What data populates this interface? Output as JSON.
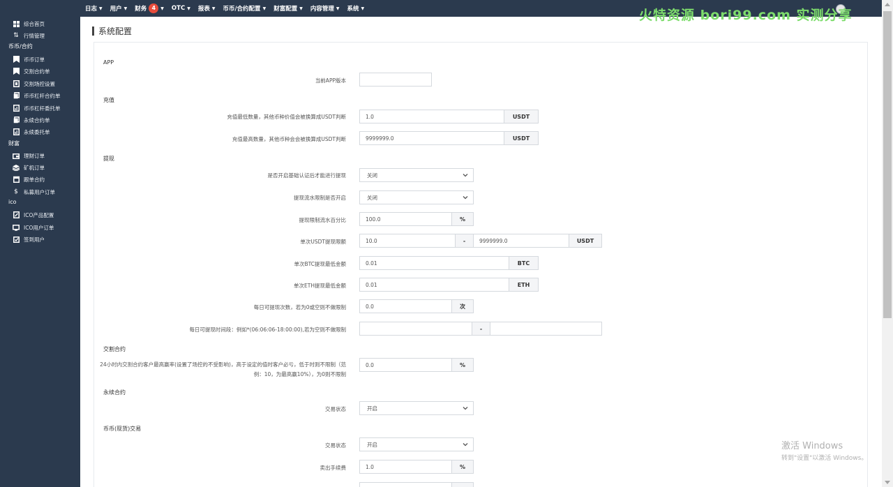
{
  "topnav": {
    "menu": [
      {
        "label": "日志"
      },
      {
        "label": "用户"
      },
      {
        "label": "财务",
        "badge": "4"
      },
      {
        "label": "OTC"
      },
      {
        "label": "报表"
      },
      {
        "label": "币币/合约配置"
      },
      {
        "label": "财富配置"
      },
      {
        "label": "内容管理"
      },
      {
        "label": "系统"
      }
    ],
    "watermark": "火特资源 bori99.com 实测分享"
  },
  "sidebar": {
    "items_top": [
      {
        "label": "综合首页",
        "icon": "dashboard-icon"
      },
      {
        "label": "行情管理",
        "icon": "market-icon"
      }
    ],
    "group1": "币币/合约",
    "group1_items": [
      {
        "label": "币币订单",
        "icon": "bookmark-icon"
      },
      {
        "label": "交割合约单",
        "icon": "bookmark-icon"
      },
      {
        "label": "交割场控设置",
        "icon": "settings-doc-icon"
      },
      {
        "label": "币币杠杆合约单",
        "icon": "copy-icon"
      },
      {
        "label": "币币杠杆委托单",
        "icon": "chart-doc-icon"
      },
      {
        "label": "永续合约单",
        "icon": "copy-icon"
      },
      {
        "label": "永续委托单",
        "icon": "chart-doc-icon"
      }
    ],
    "group2": "财富",
    "group2_items": [
      {
        "label": "理财订单",
        "icon": "wallet-icon"
      },
      {
        "label": "矿机订单",
        "icon": "layers-icon"
      },
      {
        "label": "跟单合约",
        "icon": "calendar-icon"
      },
      {
        "label": "私募用户订单",
        "icon": "dollar-icon"
      }
    ],
    "group3": "ico",
    "group3_items": [
      {
        "label": "ICO产品配置",
        "icon": "edit-doc-icon"
      },
      {
        "label": "ICO用户订单",
        "icon": "monitor-icon"
      },
      {
        "label": "签到用户",
        "icon": "checkin-icon"
      }
    ]
  },
  "page": {
    "title": "系统配置"
  },
  "sections": {
    "app": "APP",
    "recharge": "充值",
    "withdraw": "提现",
    "delivery": "交割合约",
    "perpetual": "永续合约",
    "spot": "币币(现货)交易"
  },
  "form": {
    "app_version": {
      "label": "当前APP版本",
      "value": ""
    },
    "recharge_min": {
      "label": "充值最低数量，其他币种价值会被换算成USDT判断",
      "value": "1.0",
      "unit": "USDT"
    },
    "recharge_max": {
      "label": "充值最高数量，其他币种会会被换算成USDT判断",
      "value": "9999999.0",
      "unit": "USDT"
    },
    "withdraw_kyc": {
      "label": "是否开启基础认证后才能进行提现",
      "value": "关闭"
    },
    "withdraw_flow": {
      "label": "提现流水限制是否开启",
      "value": "关闭"
    },
    "withdraw_flow_pct": {
      "label": "提现限制流水百分比",
      "value": "100.0",
      "unit": "%"
    },
    "usdt_limit": {
      "label": "单次USDT提现限额",
      "min": "10.0",
      "sep": "-",
      "max": "9999999.0",
      "unit": "USDT"
    },
    "btc_min": {
      "label": "单次BTC提现最低金额",
      "value": "0.01",
      "unit": "BTC"
    },
    "eth_min": {
      "label": "单次ETH提现最低金额",
      "value": "0.01",
      "unit": "ETH"
    },
    "daily_count": {
      "label": "每日可提现次数，若为0或空则不做限制",
      "value": "0.0",
      "unit": "次"
    },
    "daily_time": {
      "label": "每日可提现时间段：例如*(06:06:06-18:00:00),若为空则不做限制",
      "from": "",
      "sep": "-",
      "to": ""
    },
    "delivery_rate": {
      "label": "24小时内交割合约客户最高赢率(设置了场控的不受影响)，高于设定的值时客户必亏，低于时则不限制（范例：10，为最高赢10%），为0则不限制",
      "value": "0.0",
      "unit": "%"
    },
    "perpetual_status": {
      "label": "交易状态",
      "value": "开启"
    },
    "spot_status": {
      "label": "交易状态",
      "value": "开启"
    },
    "sell_fee": {
      "label": "卖出手续费",
      "value": "1.0",
      "unit": "%"
    }
  },
  "windows": {
    "line1": "激活 Windows",
    "line2": "转到\"设置\"以激活 Windows。"
  }
}
